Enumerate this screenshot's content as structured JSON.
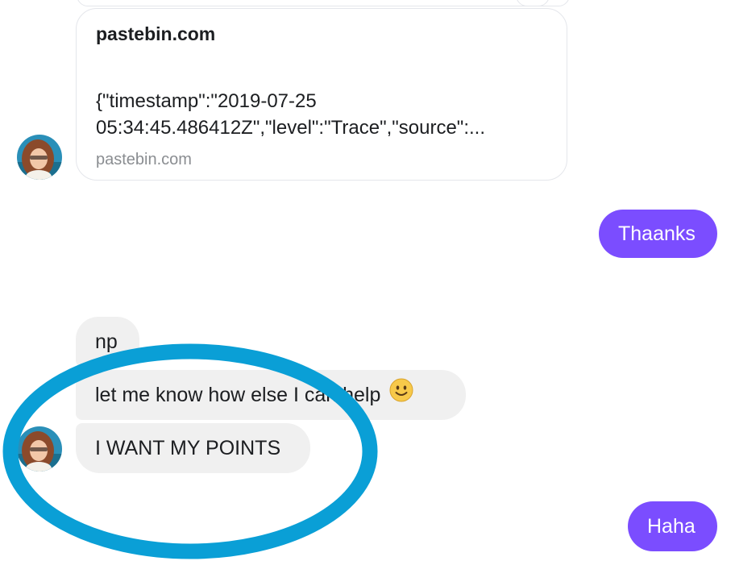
{
  "link_preview": {
    "title": "pastebin.com",
    "description": "{\"timestamp\":\"2019-07-25 05:34:45.486412Z\",\"level\":\"Trace\",\"source\":...",
    "domain": "pastebin.com"
  },
  "messages": {
    "outgoing_1": "Thaanks",
    "incoming_1": "np",
    "incoming_2": "let me know how else I can help",
    "incoming_3": "I WANT MY POINTS",
    "outgoing_2": "Haha"
  },
  "icons": {
    "emoji": "slightly-smiling-face-icon",
    "avatar": "contact-avatar"
  },
  "colors": {
    "outgoing_bubble": "#7b4dff",
    "incoming_bubble": "#f0f0f0",
    "highlight_ring": "#0a9fd6"
  }
}
